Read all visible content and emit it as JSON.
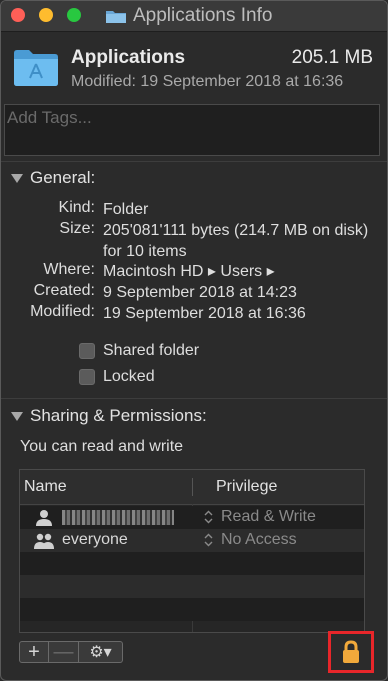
{
  "window": {
    "title": "Applications Info"
  },
  "header": {
    "name": "Applications",
    "size": "205.1 MB",
    "modified": "Modified: 19 September 2018 at 16:36"
  },
  "tags": {
    "placeholder": "Add Tags..."
  },
  "general": {
    "title": "General:",
    "rows": [
      {
        "label": "Kind:",
        "value": "Folder"
      },
      {
        "label": "Size:",
        "value": "205'081'111 bytes (214.7 MB on disk) for 10 items"
      },
      {
        "label": "Where:",
        "value": "Macintosh HD ▸ Users ▸"
      },
      {
        "label": "Created:",
        "value": "9 September 2018 at 14:23"
      },
      {
        "label": "Modified:",
        "value": "19 September 2018 at 16:36"
      }
    ],
    "checkboxes": [
      {
        "label": "Shared folder",
        "checked": false
      },
      {
        "label": "Locked",
        "checked": false
      }
    ]
  },
  "sharing": {
    "title": "Sharing & Permissions:",
    "access_text": "You can read and write",
    "columns": [
      "Name",
      "Privilege"
    ],
    "rows": [
      {
        "name": "",
        "privilege": "Read & Write",
        "icon": "user-icon"
      },
      {
        "name": "everyone",
        "privilege": "No Access",
        "icon": "group-icon"
      }
    ]
  },
  "toolbar": {
    "add_label": "+",
    "remove_label": "—",
    "action_label": "⚙▾"
  },
  "colors": {
    "lock_highlight": "#e8262a",
    "lock": "#f2a93b",
    "folder": "#5fb2e8"
  }
}
